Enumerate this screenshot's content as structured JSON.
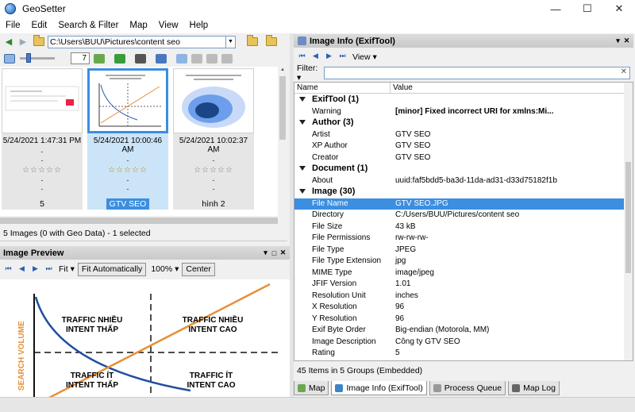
{
  "window": {
    "title": "GeoSetter",
    "controls": [
      "—",
      "☐",
      "✕"
    ]
  },
  "menu": [
    "File",
    "Edit",
    "Search & Filter",
    "Map",
    "View",
    "Help"
  ],
  "address": {
    "path": "C:\\Users\\BUU\\Pictures\\content seo"
  },
  "thumb_size": "7",
  "thumbnails": [
    {
      "date": "5/24/2021 1:47:31 PM",
      "stars": "☆☆☆☆☆",
      "label": "5",
      "selected": false
    },
    {
      "date": "5/24/2021 10:00:46 AM",
      "stars": "☆☆☆☆☆",
      "label": "GTV SEO",
      "selected": true
    },
    {
      "date": "5/24/2021 10:02:37 AM",
      "stars": "☆☆☆☆☆",
      "label": "hình 2",
      "selected": false
    }
  ],
  "dash": "-",
  "status_left": "5 Images (0 with Geo Data) - 1 selected",
  "preview": {
    "title": "Image Preview",
    "fit": "Fit ▾",
    "fit_auto": "Fit Automatically",
    "zoom": "100% ▾",
    "center": "Center",
    "chart": {
      "ylabel": "SEARCH VOLUME",
      "q1": [
        "TRAFFIC NHIỀU",
        "INTENT THẤP"
      ],
      "q2": [
        "TRAFFIC NHIỀU",
        "INTENT CAO"
      ],
      "q3": [
        "TRAFFIC ÍT",
        "INTENT THẤP"
      ],
      "q4": [
        "TRAFFIC ÍT",
        "INTENT CAO"
      ]
    }
  },
  "info": {
    "title": "Image Info (ExifTool)",
    "view": "View ▾",
    "filter_label": "Filter: ▾",
    "col_name": "Name",
    "col_value": "Value",
    "rows": [
      {
        "type": "group",
        "k": "ExifTool (1)"
      },
      {
        "type": "item",
        "k": "Warning",
        "v": "[minor] Fixed incorrect URI for xmlns:Mi...",
        "bold": true
      },
      {
        "type": "group",
        "k": "Author (3)"
      },
      {
        "type": "item",
        "k": "Artist",
        "v": "GTV SEO"
      },
      {
        "type": "item",
        "k": "XP Author",
        "v": "GTV SEO"
      },
      {
        "type": "item",
        "k": "Creator",
        "v": "GTV SEO"
      },
      {
        "type": "group",
        "k": "Document (1)"
      },
      {
        "type": "item",
        "k": "About",
        "v": "uuid:faf5bdd5-ba3d-11da-ad31-d33d75182f1b"
      },
      {
        "type": "group",
        "k": "Image (30)"
      },
      {
        "type": "item",
        "k": "File Name",
        "v": "GTV SEO.JPG",
        "selected": true
      },
      {
        "type": "item",
        "k": "Directory",
        "v": "C:/Users/BUU/Pictures/content seo"
      },
      {
        "type": "item",
        "k": "File Size",
        "v": "43 kB"
      },
      {
        "type": "item",
        "k": "File Permissions",
        "v": "rw-rw-rw-"
      },
      {
        "type": "item",
        "k": "File Type",
        "v": "JPEG"
      },
      {
        "type": "item",
        "k": "File Type Extension",
        "v": "jpg"
      },
      {
        "type": "item",
        "k": "MIME Type",
        "v": "image/jpeg"
      },
      {
        "type": "item",
        "k": "JFIF Version",
        "v": "1.01"
      },
      {
        "type": "item",
        "k": "Resolution Unit",
        "v": "inches"
      },
      {
        "type": "item",
        "k": "X Resolution",
        "v": "96"
      },
      {
        "type": "item",
        "k": "Y Resolution",
        "v": "96"
      },
      {
        "type": "item",
        "k": "Exif Byte Order",
        "v": "Big-endian (Motorola, MM)"
      },
      {
        "type": "item",
        "k": "Image Description",
        "v": "Công ty GTV SEO"
      },
      {
        "type": "item",
        "k": "Rating",
        "v": "5"
      }
    ],
    "status": "45 Items in 5 Groups   (Embedded)"
  },
  "tabs": [
    {
      "label": "Map",
      "active": false,
      "color": "#6aa84f"
    },
    {
      "label": "Image Info (ExifTool)",
      "active": true,
      "color": "#3d85c6"
    },
    {
      "label": "Process Queue",
      "active": false,
      "color": "#999999"
    },
    {
      "label": "Map Log",
      "active": false,
      "color": "#666666"
    }
  ]
}
